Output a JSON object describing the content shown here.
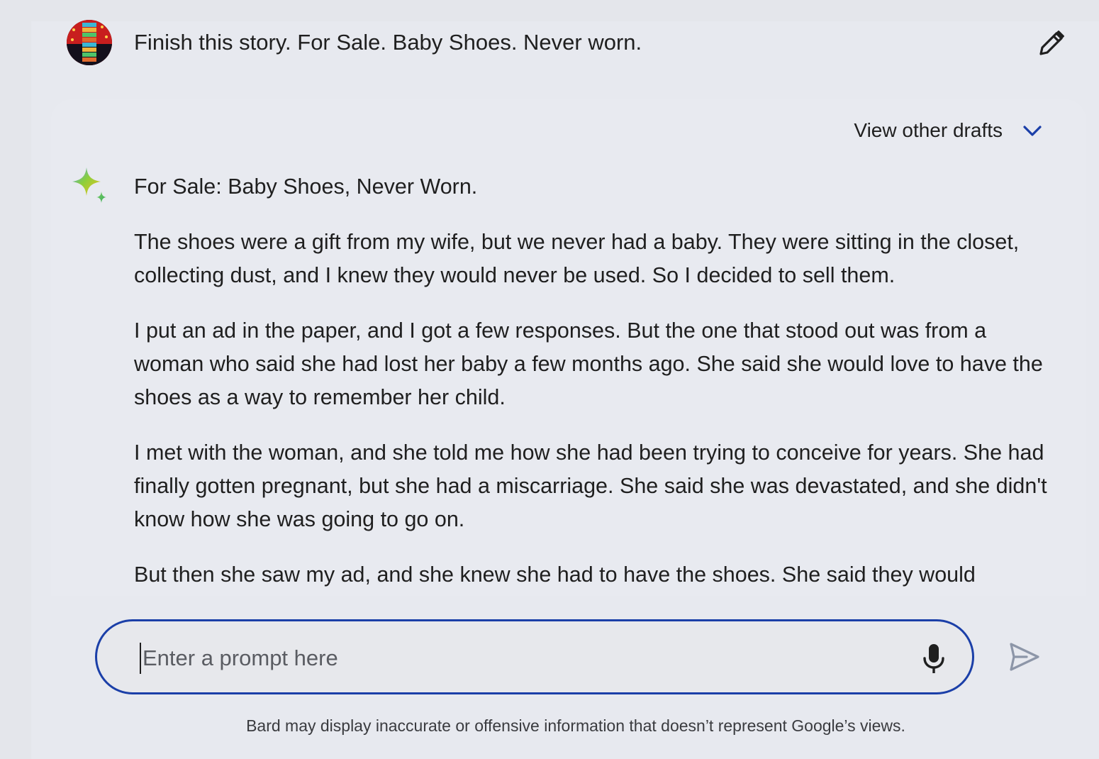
{
  "prompt": {
    "text": "Finish this story. For Sale. Baby Shoes. Never worn.",
    "edit_icon": "pencil-icon"
  },
  "response": {
    "view_drafts_label": "View other drafts",
    "drafts_icon": "chevron-down-icon",
    "assistant_icon": "sparkle-icon",
    "paragraphs": [
      "For Sale: Baby Shoes, Never Worn.",
      "The shoes were a gift from my wife, but we never had a baby. They were sitting in the closet, collecting dust, and I knew they would never be used. So I decided to sell them.",
      "I put an ad in the paper, and I got a few responses. But the one that stood out was from a woman who said she had lost her baby a few months ago. She said she would love to have the shoes as a way to remember her child.",
      "I met with the woman, and she told me how she had been trying to conceive for years. She had finally gotten pregnant, but she had a miscarriage. She said she was devastated, and she didn't know how she was going to go on.",
      "But then she saw my ad, and she knew she had to have the shoes. She said they would"
    ]
  },
  "input": {
    "placeholder": "Enter a prompt here",
    "value": "",
    "mic_icon": "microphone-icon",
    "send_icon": "send-icon"
  },
  "footer": {
    "disclaimer": "Bard may display inaccurate or offensive information that doesn’t represent Google’s views."
  },
  "colors": {
    "background": "#e4e6eb",
    "input_border": "#1b3fa8",
    "chevron": "#1b3fa8",
    "send_icon": "#8d96a8"
  }
}
